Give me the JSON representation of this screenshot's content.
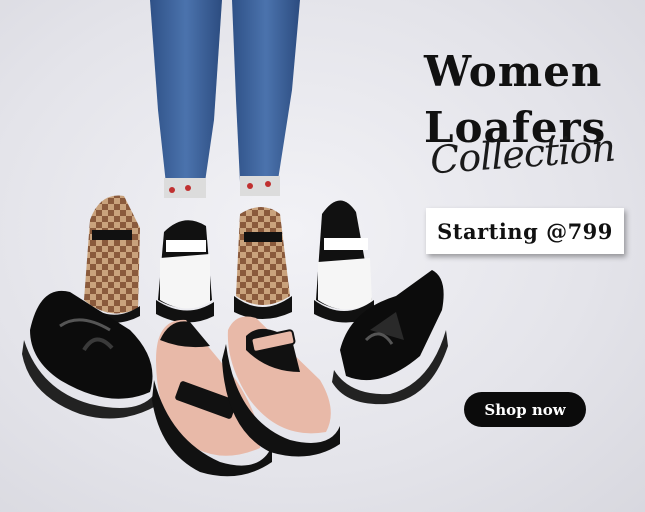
{
  "banner": {
    "title_line1": "Women",
    "title_line2": "Loafers",
    "script_text": "Collection",
    "price_text": "Starting @799",
    "cta_label": "Shop now"
  },
  "colors": {
    "background": "#e7e7ec",
    "text": "#111111",
    "button_bg": "#0b0b0b",
    "button_text": "#ffffff",
    "denim": "#3a5f9a",
    "patent_black": "#0c0c0c",
    "blush_pink": "#e8b9a8",
    "checker_brown": "#8a5a3c"
  }
}
